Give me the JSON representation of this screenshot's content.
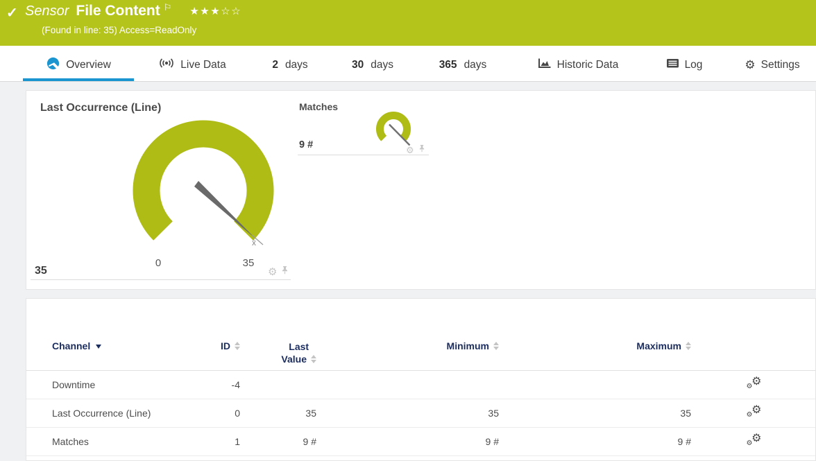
{
  "header": {
    "check_icon": "✓",
    "kind": "Sensor",
    "title": "File Content",
    "flag_icon": "⚐",
    "stars_filled": "★★★",
    "stars_empty": "☆☆",
    "subtitle": "(Found in line: 35) Access=ReadOnly"
  },
  "tabs": {
    "overview": {
      "label": "Overview"
    },
    "live_data": {
      "label": "Live Data"
    },
    "days2": {
      "number": "2",
      "label": "days"
    },
    "days30": {
      "number": "30",
      "label": "days"
    },
    "days365": {
      "number": "365",
      "label": "days"
    },
    "historic": {
      "label": "Historic Data"
    },
    "log": {
      "label": "Log"
    },
    "settings": {
      "label": "Settings"
    }
  },
  "gauges": {
    "primary": {
      "title": "Last Occurrence (Line)",
      "value": "35",
      "scale_min": "0",
      "scale_max": "35",
      "avg_marker": "x̄"
    },
    "secondary": {
      "title": "Matches",
      "value": "9 #"
    }
  },
  "channels_table": {
    "columns": {
      "channel": "Channel",
      "id": "ID",
      "last_value_line1": "Last",
      "last_value_line2": "Value",
      "minimum": "Minimum",
      "maximum": "Maximum"
    },
    "rows": [
      {
        "channel": "Downtime",
        "id": "-4",
        "last_value": "",
        "minimum": "",
        "maximum": ""
      },
      {
        "channel": "Last Occurrence (Line)",
        "id": "0",
        "last_value": "35",
        "minimum": "35",
        "maximum": "35"
      },
      {
        "channel": "Matches",
        "id": "1",
        "last_value": "9 #",
        "minimum": "9 #",
        "maximum": "9 #"
      }
    ]
  },
  "chart_data": [
    {
      "type": "gauge",
      "title": "Last Occurrence (Line)",
      "value": 35,
      "min": 0,
      "max": 35,
      "average_marker": 35
    },
    {
      "type": "gauge",
      "title": "Matches",
      "value": 9,
      "unit": "#"
    }
  ],
  "icons": {
    "gear_glyph": "⚙"
  },
  "colors": {
    "accent_green": "#b5c41b",
    "gauge_green": "#aebc15",
    "tab_active_blue": "#1b95d0",
    "table_header_navy": "#1b2c5e"
  }
}
